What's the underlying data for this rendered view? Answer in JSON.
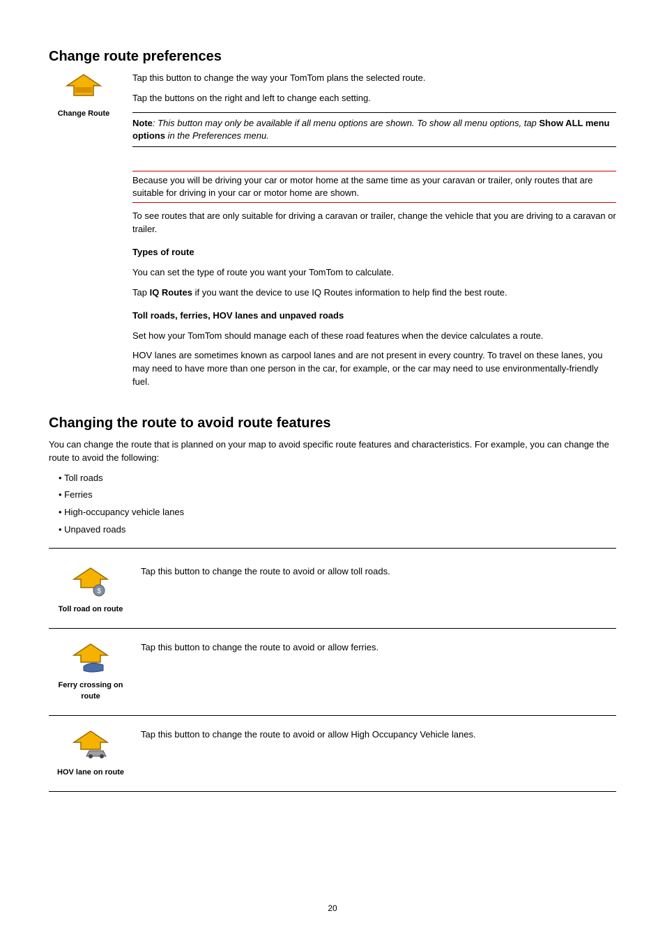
{
  "section1": {
    "title": "Change route preferences",
    "icon_label": "Change Route",
    "intro_line1": "Tap this button to change the way your TomTom plans the selected route.",
    "intro_line2": "Tap the buttons on the right and left to change each setting.",
    "note_prefix": "Note",
    "note_body": ": This button may only be available if all menu options are shown. To show all menu options, tap ",
    "note_link": "Show ALL menu options",
    "note_suffix": " in the Preferences menu.",
    "warn1": "Because you will be driving your car or motor home at the same time as your caravan or trailer, only routes that are suitable for driving in your car or motor home are shown.",
    "warn2": "To see routes that are only suitable for driving a caravan or trailer, change the vehicle that you are driving to a caravan or trailer.",
    "subhead": "Types of route",
    "sub_intro": "You can set the type of route you want your TomTom to calculate.",
    "sub_tap": "Tap ",
    "sub_iq": "IQ Routes",
    "sub_after": " if you want the device to use IQ Routes information to help find the best route.",
    "subhead2": "Toll roads, ferries, HOV lanes and unpaved roads",
    "sub2_intro": "Set how your TomTom should manage each of these road features when the device calculates a route.",
    "sub2_extra": "HOV lanes are sometimes known as carpool lanes and are not present in every country. To travel on these lanes, you may need to have more than one person in the car, for example, or the car may need to use environmentally-friendly fuel."
  },
  "section2": {
    "title": "Changing the route to avoid route features",
    "intro": "You can change the route that is planned on your map to avoid specific route features and characteristics. For example, you can change the route to avoid the following:",
    "bullets": [
      "Toll roads",
      "Ferries",
      "High-occupancy vehicle lanes",
      "Unpaved roads"
    ]
  },
  "features": [
    {
      "label": "Toll road on route",
      "desc": "Tap this button to change the route to avoid or allow toll roads."
    },
    {
      "label": "Ferry crossing on route",
      "desc": "Tap this button to change the route to avoid or allow ferries."
    },
    {
      "label": "HOV lane on route",
      "desc": "Tap this button to change the route to avoid or allow High Occupancy Vehicle lanes."
    }
  ],
  "page_number": "20"
}
